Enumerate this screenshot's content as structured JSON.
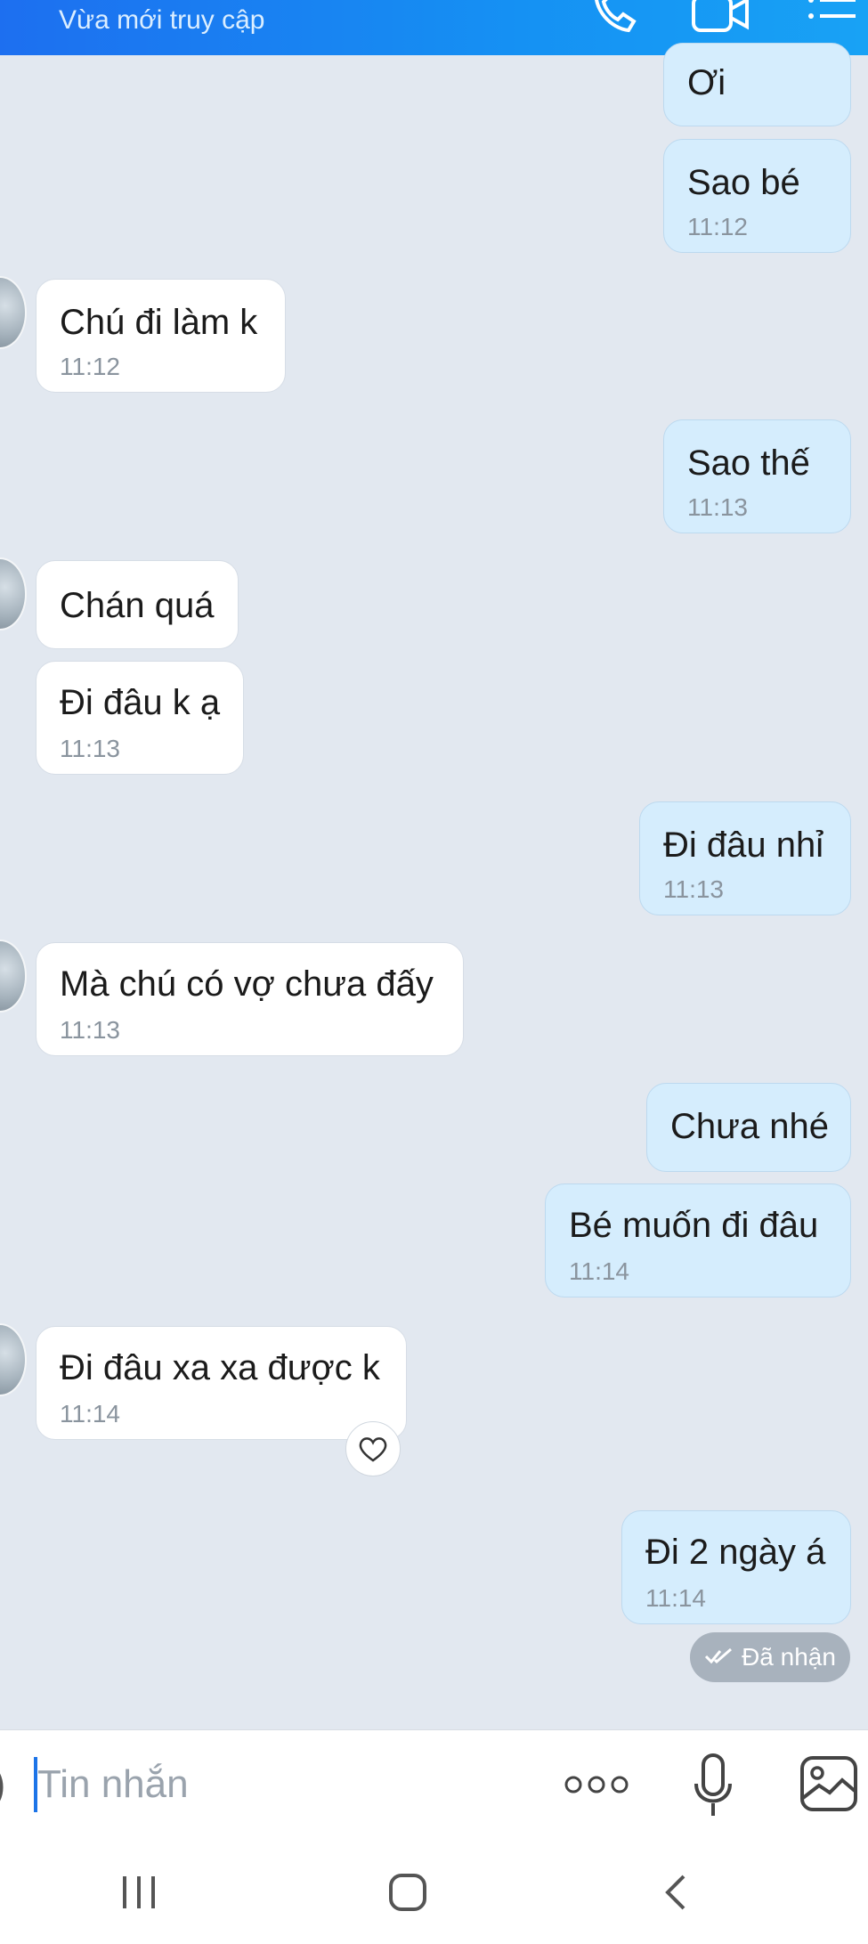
{
  "header": {
    "subtitle": "Vừa mới truy cập"
  },
  "messages": [
    {
      "text": "Ơi",
      "time": ""
    },
    {
      "text": "Sao bé",
      "time": "11:12"
    },
    {
      "text": "Chú đi làm k",
      "time": "11:12"
    },
    {
      "text": "Sao thế",
      "time": "11:13"
    },
    {
      "text": "Chán quá",
      "time": ""
    },
    {
      "text": "Đi đâu k ạ",
      "time": "11:13"
    },
    {
      "text": "Đi đâu nhỉ",
      "time": "11:13"
    },
    {
      "text": "Mà chú có vợ chưa đấy",
      "time": "11:13"
    },
    {
      "text": "Chưa nhé",
      "time": ""
    },
    {
      "text": "Bé muốn đi đâu",
      "time": "11:14"
    },
    {
      "text": "Đi đâu xa xa được k",
      "time": "11:14"
    },
    {
      "text": "Đi 2 ngày á",
      "time": "11:14"
    }
  ],
  "status": {
    "label": "Đã nhận"
  },
  "composer": {
    "placeholder": "Tin nhắn"
  },
  "icons": {
    "header": [
      "phone-icon",
      "video-call-icon",
      "menu-icon"
    ],
    "composer": [
      "more-icon",
      "microphone-icon",
      "image-icon"
    ],
    "nav": [
      "recent-apps-icon",
      "home-icon",
      "back-icon"
    ]
  },
  "colors": {
    "header": "#1d80f0",
    "outgoing_bubble": "#d5edfd",
    "incoming_bubble": "#ffffff",
    "chat_bg": "#e2e8f0"
  }
}
